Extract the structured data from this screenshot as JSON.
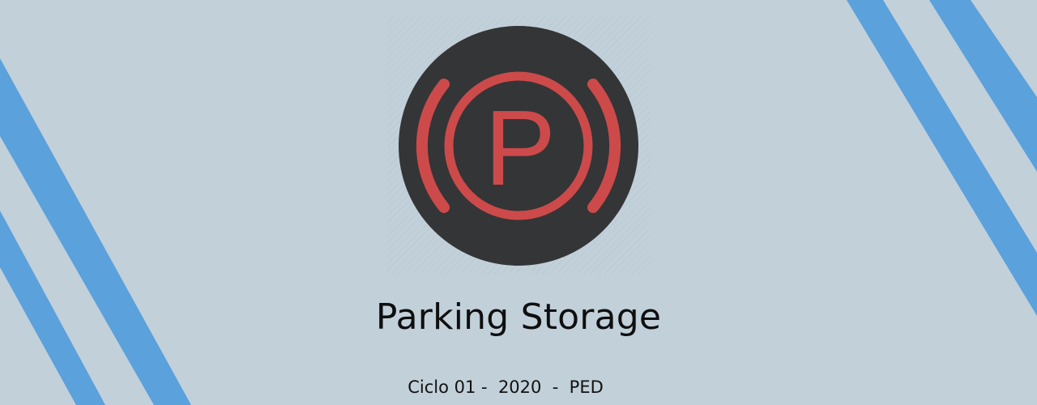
{
  "slide": {
    "title": "Parking Storage",
    "subtitle": "Ciclo 01 -  2020  -  PED"
  },
  "logo": {
    "icon": "parking-brake-icon",
    "glyph": "P",
    "circle_color": "#343537",
    "symbol_color": "#cd4a4a"
  },
  "colors": {
    "background": "#c2d0da",
    "stripe": "#5ba1dc",
    "text": "#0f0f10"
  }
}
